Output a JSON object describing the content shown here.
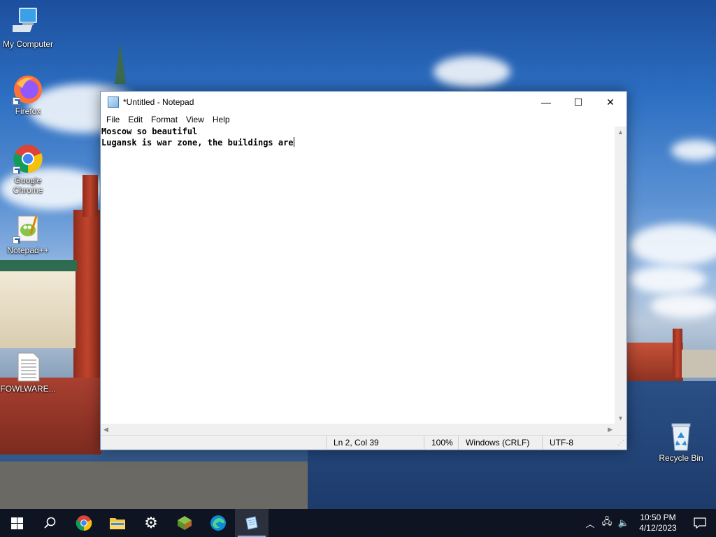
{
  "desktop": {
    "icons": [
      {
        "label": "My Computer",
        "icon": "computer-icon"
      },
      {
        "label": "Firefox",
        "icon": "firefox-icon"
      },
      {
        "label": "Google Chrome",
        "icon": "chrome-icon"
      },
      {
        "label": "Notepad++",
        "icon": "notepadpp-icon"
      },
      {
        "label": "FOWLWARE...",
        "icon": "text-file-icon"
      },
      {
        "label": "Recycle Bin",
        "icon": "recycle-bin-icon"
      }
    ]
  },
  "notepad": {
    "title": "*Untitled - Notepad",
    "controls": {
      "minimize": "—",
      "maximize": "☐",
      "close": "✕"
    },
    "menu": [
      "File",
      "Edit",
      "Format",
      "View",
      "Help"
    ],
    "content": {
      "line1": "Moscow so beautiful",
      "line2": "Lugansk is war zone, the buildings are"
    },
    "status": {
      "position": "Ln 2, Col 39",
      "zoom": "100%",
      "line_ending": "Windows (CRLF)",
      "encoding": "UTF-8"
    }
  },
  "taskbar": {
    "apps": [
      {
        "name": "start",
        "icon": "windows-start-icon"
      },
      {
        "name": "search",
        "icon": "search-icon"
      },
      {
        "name": "chrome",
        "icon": "chrome-icon"
      },
      {
        "name": "file-explorer",
        "icon": "folder-icon"
      },
      {
        "name": "settings",
        "icon": "gear-icon"
      },
      {
        "name": "app",
        "icon": "green-cube-icon"
      },
      {
        "name": "edge",
        "icon": "edge-icon"
      },
      {
        "name": "notepad",
        "icon": "notepad-icon",
        "active": true
      }
    ],
    "clock": {
      "time": "10:50 PM",
      "date": "4/12/2023"
    }
  },
  "colors": {
    "window_border": "#6b8bb8",
    "taskbar": "#0e121c",
    "accent": "#1a5fb4"
  }
}
